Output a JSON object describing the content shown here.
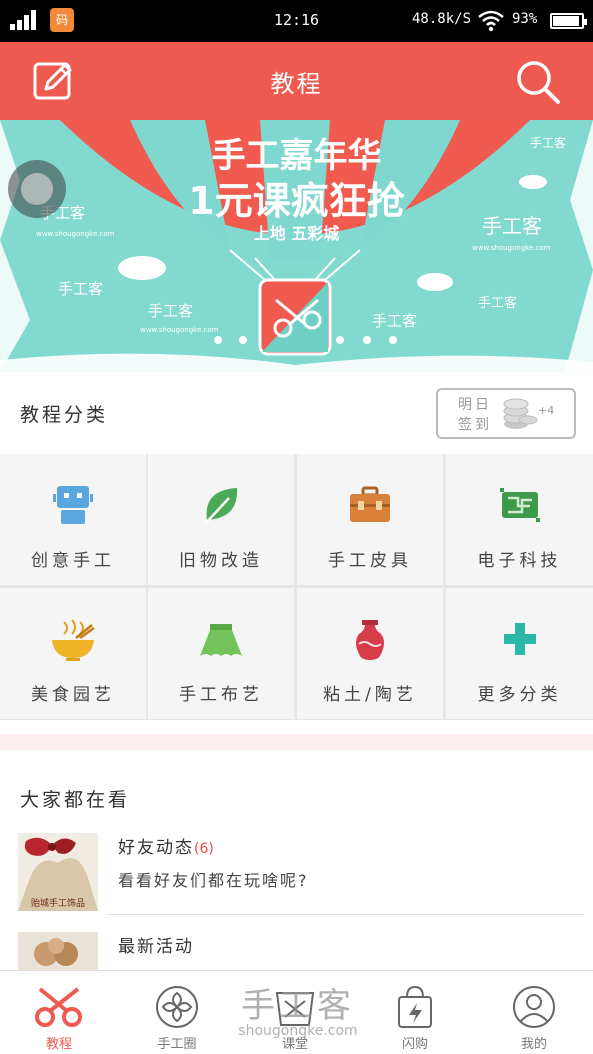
{
  "status_bar": {
    "time": "12:16",
    "network_speed": "48.8k/S",
    "battery_percent": "93%",
    "battery_level": 0.93,
    "app_icon_text": "码"
  },
  "header": {
    "title": "教程",
    "left_icon": "edit-icon",
    "right_icon": "search-icon",
    "background_color": "#ef5a50"
  },
  "banner": {
    "headline": "手工嘉年华",
    "subheadline": "1元课疯狂抢",
    "tagline": "上地 五彩城",
    "watermark_text": "手工客",
    "watermark_url": "www.shougongke.com"
  },
  "categories": {
    "title": "教程分类",
    "checkin": {
      "line1": "明日",
      "line2": "签到",
      "bonus": "+4"
    },
    "items": [
      {
        "label": "创意手工",
        "icon": "robot-icon",
        "color": "#5aa7e0"
      },
      {
        "label": "旧物改造",
        "icon": "leaf-icon",
        "color": "#4aaa55"
      },
      {
        "label": "手工皮具",
        "icon": "briefcase-icon",
        "color": "#d9813b"
      },
      {
        "label": "电子科技",
        "icon": "circuit-board-icon",
        "color": "#3d9a4b"
      },
      {
        "label": "美食园艺",
        "icon": "noodle-bowl-icon",
        "color": "#f0b429"
      },
      {
        "label": "手工布艺",
        "icon": "skirt-icon",
        "color": "#74c35a"
      },
      {
        "label": "粘土/陶艺",
        "icon": "vase-icon",
        "color": "#d63c4a"
      },
      {
        "label": "更多分类",
        "icon": "plus-icon",
        "color": "#2bb7a5"
      }
    ]
  },
  "feed": {
    "title": "大家都在看",
    "items": [
      {
        "title": "好友动态",
        "count": "(6)",
        "description": "看看好友们都在玩啥呢?",
        "thumb_caption": "贻城手工饰品"
      },
      {
        "title": "最新活动",
        "description": "",
        "thumb_caption": ""
      }
    ]
  },
  "tabbar": {
    "tabs": [
      {
        "label": "教程",
        "icon": "scissors-icon",
        "active": true
      },
      {
        "label": "手工圈",
        "icon": "flower-icon",
        "active": false
      },
      {
        "label": "课堂",
        "icon": "classroom-icon",
        "active": false
      },
      {
        "label": "闪购",
        "icon": "shopping-bag-icon",
        "active": false
      },
      {
        "label": "我的",
        "icon": "profile-icon",
        "active": false
      }
    ]
  },
  "overlay_watermark": {
    "text": "手工客",
    "url": "shougongke.com"
  }
}
